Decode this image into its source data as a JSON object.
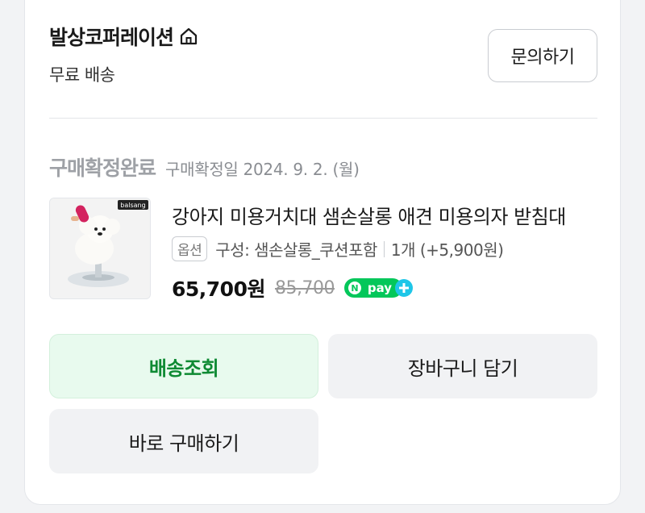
{
  "seller": {
    "name": "발상코퍼레이션",
    "shipping": "무료 배송",
    "home_icon": "home-icon"
  },
  "actions": {
    "inquiry_label": "문의하기"
  },
  "order": {
    "status": "구매확정완료",
    "confirm_date": "구매확정일 2024. 9. 2. (월)"
  },
  "product": {
    "title": "강아지 미용거치대 샘손살롱 애견 미용의자 받침대",
    "image_brand": "balsang",
    "option_badge": "옵션",
    "option_text": "구성: 샘손살롱_쿠션포함",
    "quantity_text": "1개 (+5,900원)",
    "price": "65,700원",
    "original_price": "85,700",
    "npay_label": "pay"
  },
  "buttons": {
    "track_label": "배송조회",
    "cart_label": "장바구니 담기",
    "buy_label": "바로 구매하기"
  },
  "colors": {
    "accent_green": "#0e8a33",
    "npay_green": "#03c75a",
    "status_gray": "#9ea1a6"
  }
}
